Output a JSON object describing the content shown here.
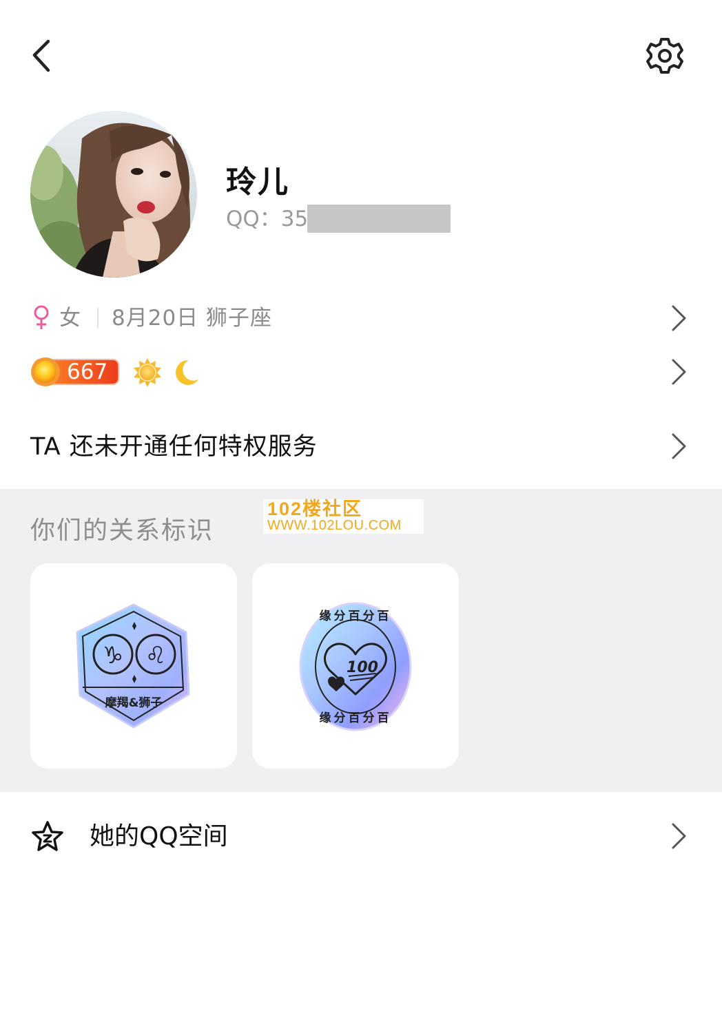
{
  "header": {
    "back_icon": "chevron-left-icon",
    "settings_icon": "gear-icon"
  },
  "profile": {
    "name": "玲儿",
    "qq_label": "QQ：35",
    "avatar": "user-avatar-photo"
  },
  "info": {
    "gender_icon": "female-icon",
    "gender": "女",
    "birthday_sign": "8月20日 狮子座"
  },
  "level": {
    "value": "667",
    "icons": [
      "crown-level-icon",
      "sun-icon",
      "moon-icon"
    ]
  },
  "privilege": {
    "text": "TA 还未开通任何特权服务"
  },
  "relation": {
    "title": "你们的关系标识",
    "badges": [
      {
        "label": "摩羯&狮子",
        "icon": "zodiac-badge-icon"
      },
      {
        "label_top": "缘分百分百",
        "label_bottom": "缘分百分百",
        "number": "100",
        "icon": "heart-100-badge-icon"
      }
    ]
  },
  "watermark": {
    "line1": "102楼社区",
    "line2": "WWW.102LOU.COM"
  },
  "space": {
    "label": "她的QQ空间",
    "icon": "star-icon"
  },
  "colors": {
    "level_badge": "#f0581e",
    "female": "#ee5a9c",
    "section_bg": "#f0f0f2",
    "watermark": "#f3a81b"
  }
}
